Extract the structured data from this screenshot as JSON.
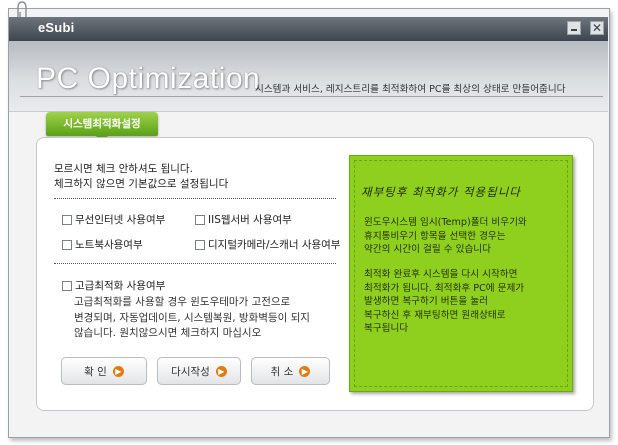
{
  "window": {
    "app_name": "eSubi",
    "title": "PC Optimization",
    "subtitle": "시스템과 서비스, 레지스트리를 최적화하여 PC를 최상의 상태로 만들어줍니다"
  },
  "tab": {
    "label": "시스템최적화설정"
  },
  "intro": [
    "모르시면 체크 안하셔도 됩니다.",
    "체크하지 않으면 기본값으로 설정됩니다"
  ],
  "options": {
    "wireless": {
      "label": "무선인터넷 사용여부",
      "checked": false
    },
    "iis": {
      "label": "IIS웹서버 사용여부",
      "checked": false
    },
    "notebook": {
      "label": "노트북사용여부",
      "checked": false
    },
    "camera": {
      "label": "디지털카메라/스캐너 사용여부",
      "checked": false
    }
  },
  "advanced": {
    "label": "고급최적화 사용여부",
    "checked": false,
    "description": [
      "고급최적화를 사용할 경우  윈도우테마가 고전으로",
      "변경되며, 자동업데이트, 시스템복원, 방화벽등이 되지",
      "않습니다. 원치않으시면 체크하지 마십시오"
    ]
  },
  "buttons": {
    "ok": "확  인",
    "rewrite": "다시작성",
    "cancel": "취  소"
  },
  "note": {
    "title": "재부팅후 최적화가 적용됩니다",
    "paragraph1": [
      "윈도우시스템 임시(Temp)폴더 비우기와",
      "휴지통비우기 항목을 선택한 경우는",
      "약간의 시간이 걸릴 수 있습니다"
    ],
    "paragraph2": [
      "최적화 완료후 시스템을 다시 시작하면",
      "최적화가 됩니다. 최적화후 PC에 문제가",
      "발생하면 복구하기 버튼을 눌러",
      "복구하신 후 재부팅하면 원래상태로",
      "복구됩니다"
    ]
  },
  "colors": {
    "accent_green": "#8fd01f",
    "titlebar": "#4a5157",
    "button_arrow": "#e07b16"
  }
}
